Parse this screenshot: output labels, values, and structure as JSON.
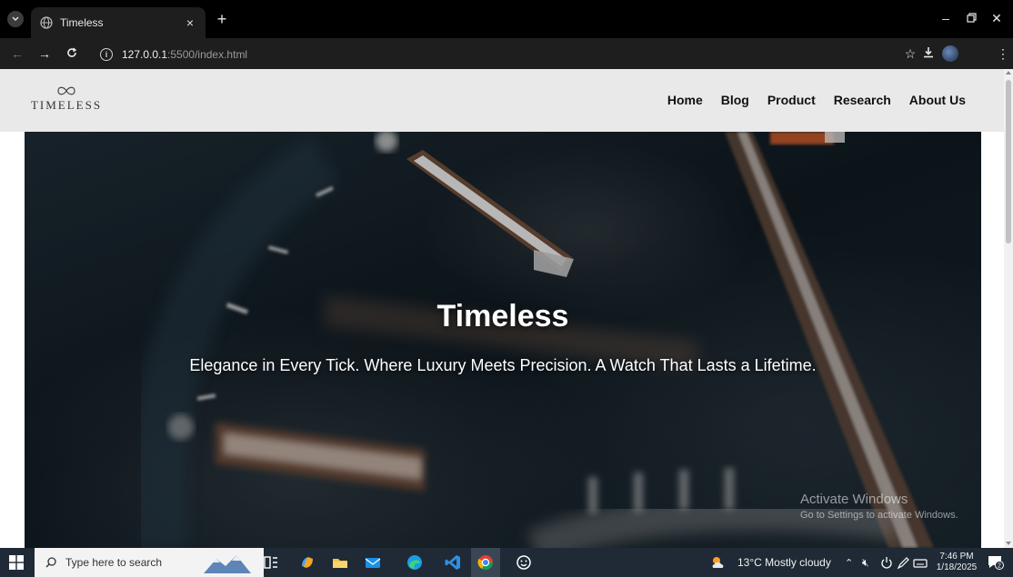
{
  "browser": {
    "tab_title": "Timeless",
    "tab_close": "×",
    "new_tab": "+",
    "url_host": "127.0.0.1",
    "url_path": ":5500/index.html"
  },
  "site": {
    "logo_text": "TIMELESS",
    "nav": [
      "Home",
      "Blog",
      "Product",
      "Research",
      "About Us"
    ]
  },
  "hero": {
    "title": "Timeless",
    "subtitle": "Elegance in Every Tick. Where Luxury Meets Precision. A Watch That Lasts a Lifetime."
  },
  "watermark": {
    "line1": "Activate Windows",
    "line2": "Go to Settings to activate Windows."
  },
  "taskbar": {
    "search_placeholder": "Type here to search",
    "weather": "13°C  Mostly cloudy",
    "time": "7:46 PM",
    "date": "1/18/2025",
    "notification_count": "2"
  },
  "colors": {
    "header_bg": "#e8e8e8",
    "hero_dark": "#0f1920",
    "taskbar_bg": "#1f2a36"
  }
}
